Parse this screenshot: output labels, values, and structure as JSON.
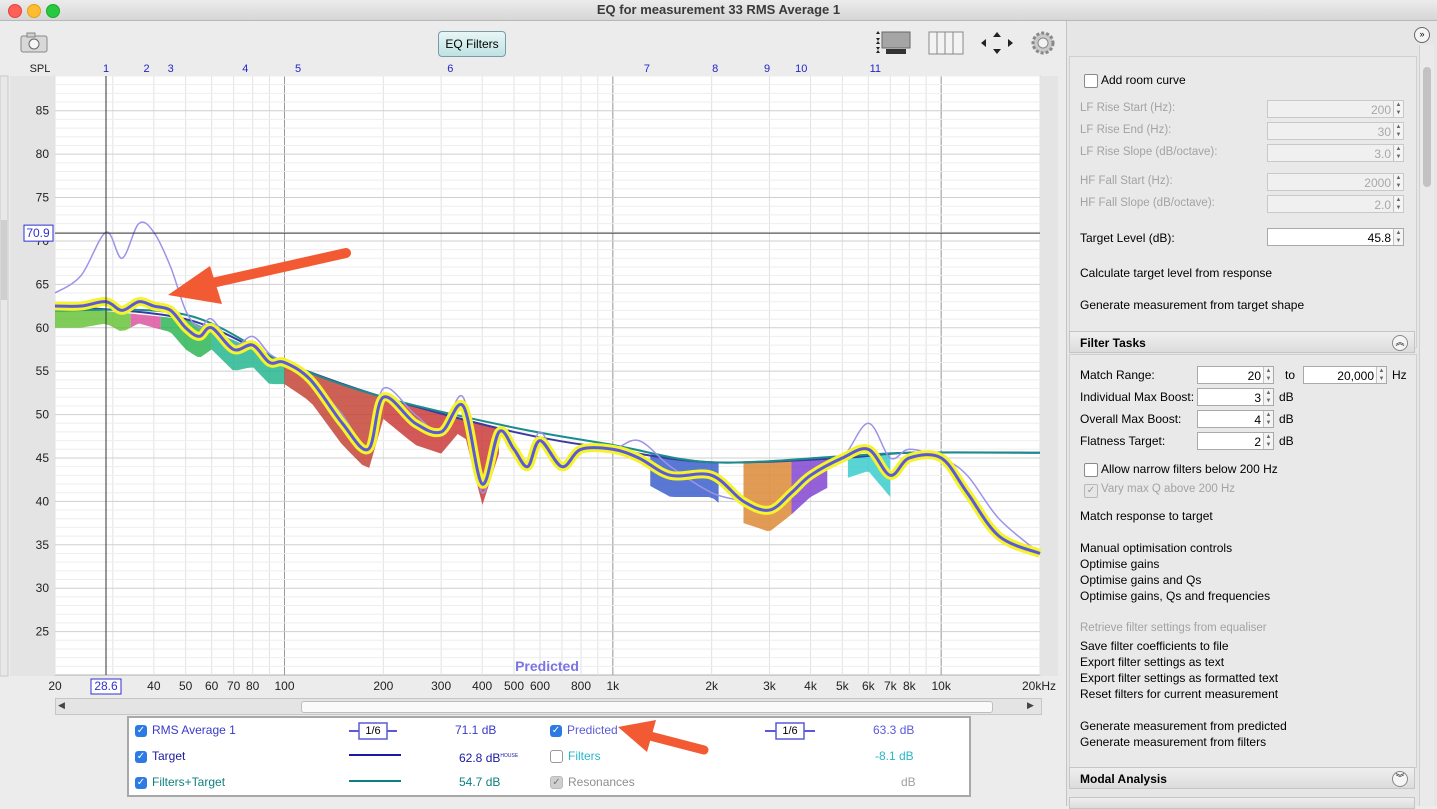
{
  "window": {
    "title": "EQ for measurement 33 RMS Average 1"
  },
  "toolbar": {
    "eq_filters_label": "EQ Filters"
  },
  "chart_data": {
    "type": "line",
    "title": "",
    "ylabel": "SPL",
    "xscale": "log",
    "xlim": [
      20,
      20000
    ],
    "ylim": [
      20,
      89
    ],
    "ytick_labels": [
      "25",
      "30",
      "35",
      "40",
      "45",
      "50",
      "55",
      "60",
      "65",
      "70",
      "75",
      "80",
      "85"
    ],
    "xtick_labels": [
      "20",
      "28.6",
      "40",
      "50",
      "60",
      "70",
      "80",
      "100",
      "200",
      "300",
      "400",
      "500",
      "600",
      "800",
      "1k",
      "2k",
      "3k",
      "4k",
      "5k",
      "6k",
      "7k",
      "8k",
      "10k",
      "20kHz"
    ],
    "xtick_values": [
      20,
      28.6,
      40,
      50,
      60,
      70,
      80,
      100,
      200,
      300,
      400,
      500,
      600,
      800,
      1000,
      2000,
      3000,
      4000,
      5000,
      6000,
      7000,
      8000,
      10000,
      20000
    ],
    "filter_markers": [
      "1",
      "2",
      "3",
      "4",
      "5",
      "6",
      "7",
      "8",
      "9",
      "10",
      "11"
    ],
    "filter_marker_freqs": [
      28.6,
      38,
      45,
      76,
      110,
      320,
      1270,
      2050,
      2950,
      3750,
      6300
    ],
    "cursor": {
      "x": 28.6,
      "y": 70.9,
      "x_label": "28.6",
      "y_label": "70.9"
    },
    "plot_label": "Predicted",
    "series": [
      {
        "name": "RMS Average 1",
        "color": "#9b93e8",
        "x": [
          20,
          24,
          28.6,
          32,
          36,
          40,
          45,
          50,
          55,
          60,
          70,
          80,
          90,
          100,
          120,
          150,
          180,
          200,
          250,
          300,
          350,
          400,
          450,
          500,
          550,
          600,
          700,
          800,
          1000,
          1200,
          1500,
          2000,
          2500,
          3000,
          3500,
          4000,
          5000,
          6000,
          7000,
          8000,
          10000,
          12000,
          15000,
          20000
        ],
        "y": [
          64,
          66,
          71,
          68,
          72,
          71,
          67,
          62,
          60,
          61,
          58,
          59,
          57,
          56,
          54,
          50,
          46,
          53,
          50,
          48,
          52,
          41,
          48,
          46,
          44,
          48,
          44,
          46,
          46,
          47,
          44,
          41,
          40,
          39,
          41,
          43,
          45,
          49,
          45,
          46,
          45,
          43,
          38,
          34
        ]
      },
      {
        "name": "Predicted",
        "color": "#5a5ad8",
        "x": [
          20,
          24,
          28.6,
          32,
          36,
          40,
          45,
          50,
          55,
          60,
          70,
          80,
          90,
          100,
          120,
          150,
          180,
          200,
          250,
          300,
          350,
          400,
          450,
          500,
          550,
          600,
          700,
          800,
          1000,
          1200,
          1500,
          2000,
          2500,
          3000,
          3500,
          4000,
          5000,
          6000,
          7000,
          8000,
          10000,
          12000,
          15000,
          20000
        ],
        "y": [
          62.5,
          62.5,
          63,
          62,
          63,
          62.5,
          62,
          60,
          59,
          60,
          57.5,
          58,
          56,
          56,
          54,
          49,
          46,
          52,
          49,
          48,
          51,
          42,
          48,
          46,
          44,
          47,
          44,
          46,
          46,
          45,
          43,
          43,
          40,
          39,
          41,
          43,
          45,
          46,
          43,
          45,
          45,
          41,
          36,
          34
        ]
      },
      {
        "name": "Target",
        "color": "#3a3aa0",
        "x": [
          20,
          50,
          100,
          200,
          500,
          1000,
          2000,
          5000,
          8000,
          20000
        ],
        "y": [
          62.5,
          61,
          56,
          52,
          48,
          46,
          44.5,
          45,
          45.6,
          45.6
        ]
      },
      {
        "name": "Filters+Target",
        "color": "#1a8c8c",
        "x": [
          20,
          50,
          100,
          200,
          500,
          1000,
          2000,
          5000,
          8000,
          20000
        ],
        "y": [
          62,
          61.5,
          56,
          52,
          48.5,
          46.5,
          44.5,
          45.2,
          45.6,
          45.6
        ]
      }
    ]
  },
  "legend": {
    "rows": [
      {
        "label": "RMS Average 1",
        "smoothing": "1/6",
        "value": "71.1 dB"
      },
      {
        "label": "Target",
        "value": "62.8 dB",
        "sup": "HOUSE"
      },
      {
        "label": "Filters+Target",
        "value": "54.7 dB"
      }
    ],
    "rows_right": [
      {
        "label": "Predicted",
        "smoothing": "1/6",
        "value": "63.3 dB"
      },
      {
        "label": "Filters",
        "value": "-8.1 dB"
      },
      {
        "label": "Resonances",
        "value": "dB"
      }
    ]
  },
  "target_settings": {
    "add_room_curve": "Add room curve",
    "lf_rise_start_label": "LF Rise Start (Hz):",
    "lf_rise_start": "200",
    "lf_rise_end_label": "LF Rise End (Hz):",
    "lf_rise_end": "30",
    "lf_rise_slope_label": "LF Rise Slope (dB/octave):",
    "lf_rise_slope": "3.0",
    "hf_fall_start_label": "HF Fall Start (Hz):",
    "hf_fall_start": "2000",
    "hf_fall_slope_label": "HF Fall Slope (dB/octave):",
    "hf_fall_slope": "2.0",
    "target_level_label": "Target Level (dB):",
    "target_level": "45.8",
    "calc_target": "Calculate target level from response",
    "gen_measurement": "Generate measurement from target shape"
  },
  "filter_tasks": {
    "header": "Filter Tasks",
    "match_range_label": "Match Range:",
    "match_from": "20",
    "to_label": "to",
    "match_to": "20,000",
    "hz_label": "Hz",
    "ind_max_boost_label": "Individual Max Boost:",
    "ind_max_boost": "3",
    "db1": "dB",
    "overall_max_boost_label": "Overall Max Boost:",
    "overall_max_boost": "4",
    "db2": "dB",
    "flatness_label": "Flatness Target:",
    "flatness": "2",
    "db3": "dB",
    "allow_narrow": "Allow narrow filters below 200 Hz",
    "vary_q": "Vary max Q above 200 Hz",
    "match_response": "Match response to target",
    "manual": "Manual optimisation controls",
    "opt_gains": "Optimise gains",
    "opt_gains_qs": "Optimise gains and Qs",
    "opt_gains_qs_freq": "Optimise gains, Qs and frequencies",
    "retrieve": "Retrieve filter settings from equaliser",
    "save_coeffs": "Save filter coefficients to file",
    "export_text": "Export filter settings as text",
    "export_formatted": "Export filter settings as formatted text",
    "reset": "Reset filters for current measurement",
    "gen_predicted": "Generate measurement from predicted",
    "gen_filters": "Generate measurement from filters"
  },
  "modal": {
    "header": "Modal Analysis"
  }
}
